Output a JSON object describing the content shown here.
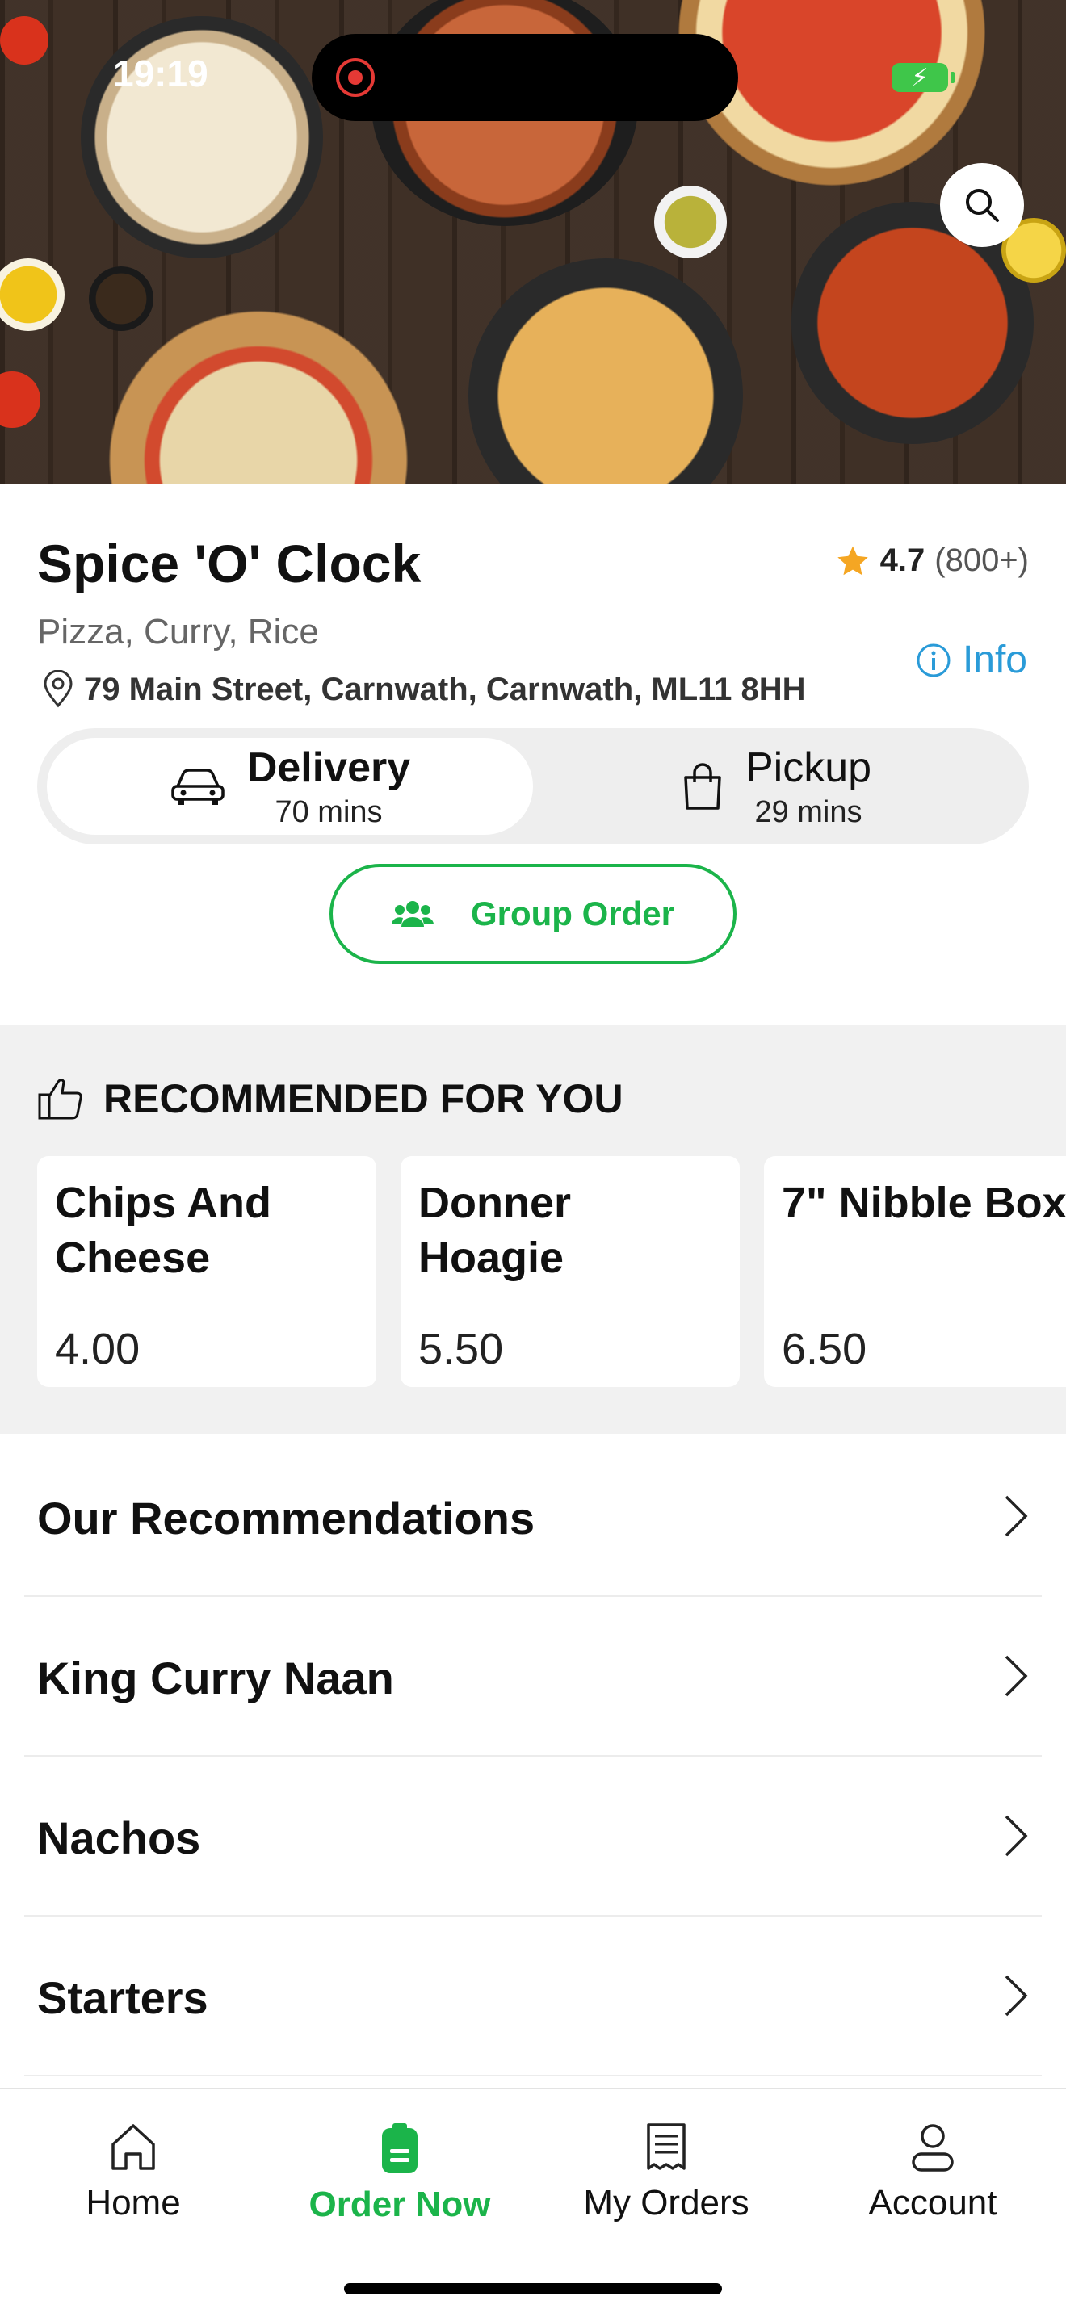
{
  "status_bar": {
    "time": "19:19"
  },
  "restaurant": {
    "name": "Spice 'O' Clock",
    "rating": "4.7",
    "rating_count": "(800+)",
    "cuisines": "Pizza, Curry, Rice",
    "address": "79 Main Street, Carnwath, Carnwath, ML11 8HH",
    "info_label": "Info"
  },
  "order_mode": {
    "delivery": {
      "label": "Delivery",
      "time": "70 mins"
    },
    "pickup": {
      "label": "Pickup",
      "time": "29 mins"
    },
    "selected": "delivery"
  },
  "group_order_label": "Group Order",
  "recommended": {
    "heading": "RECOMMENDED FOR YOU",
    "items": [
      {
        "name": "Chips And Cheese",
        "price": "4.00"
      },
      {
        "name": "Donner Hoagie",
        "price": "5.50"
      },
      {
        "name": "7\" Nibble Box",
        "price": "6.50"
      }
    ]
  },
  "categories": [
    {
      "label": "Our Recommendations"
    },
    {
      "label": "King Curry Naan"
    },
    {
      "label": "Nachos"
    },
    {
      "label": "Starters"
    }
  ],
  "tabs": [
    {
      "label": "Home",
      "icon": "home-icon"
    },
    {
      "label": "Order Now",
      "icon": "order-icon"
    },
    {
      "label": "My Orders",
      "icon": "receipt-icon"
    },
    {
      "label": "Account",
      "icon": "person-icon"
    }
  ],
  "active_tab": "Order Now",
  "colors": {
    "accent": "#1bb44a",
    "info": "#2a9bd8",
    "star": "#f5a623"
  }
}
